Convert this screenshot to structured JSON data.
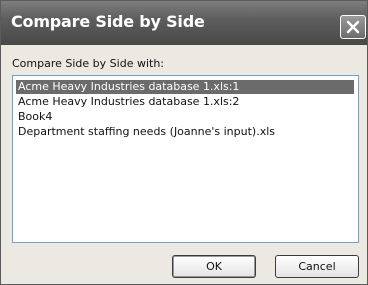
{
  "window": {
    "title": "Compare Side by Side",
    "close_icon": "close-icon"
  },
  "prompt_label": "Compare Side by Side with:",
  "workbooks": [
    {
      "label": "Acme Heavy Industries database 1.xls:1",
      "selected": true
    },
    {
      "label": "Acme Heavy Industries database 1.xls:2",
      "selected": false
    },
    {
      "label": "Book4",
      "selected": false
    },
    {
      "label": "Department staffing needs (Joanne's input).xls",
      "selected": false
    }
  ],
  "buttons": {
    "ok_label": "OK",
    "cancel_label": "Cancel"
  }
}
